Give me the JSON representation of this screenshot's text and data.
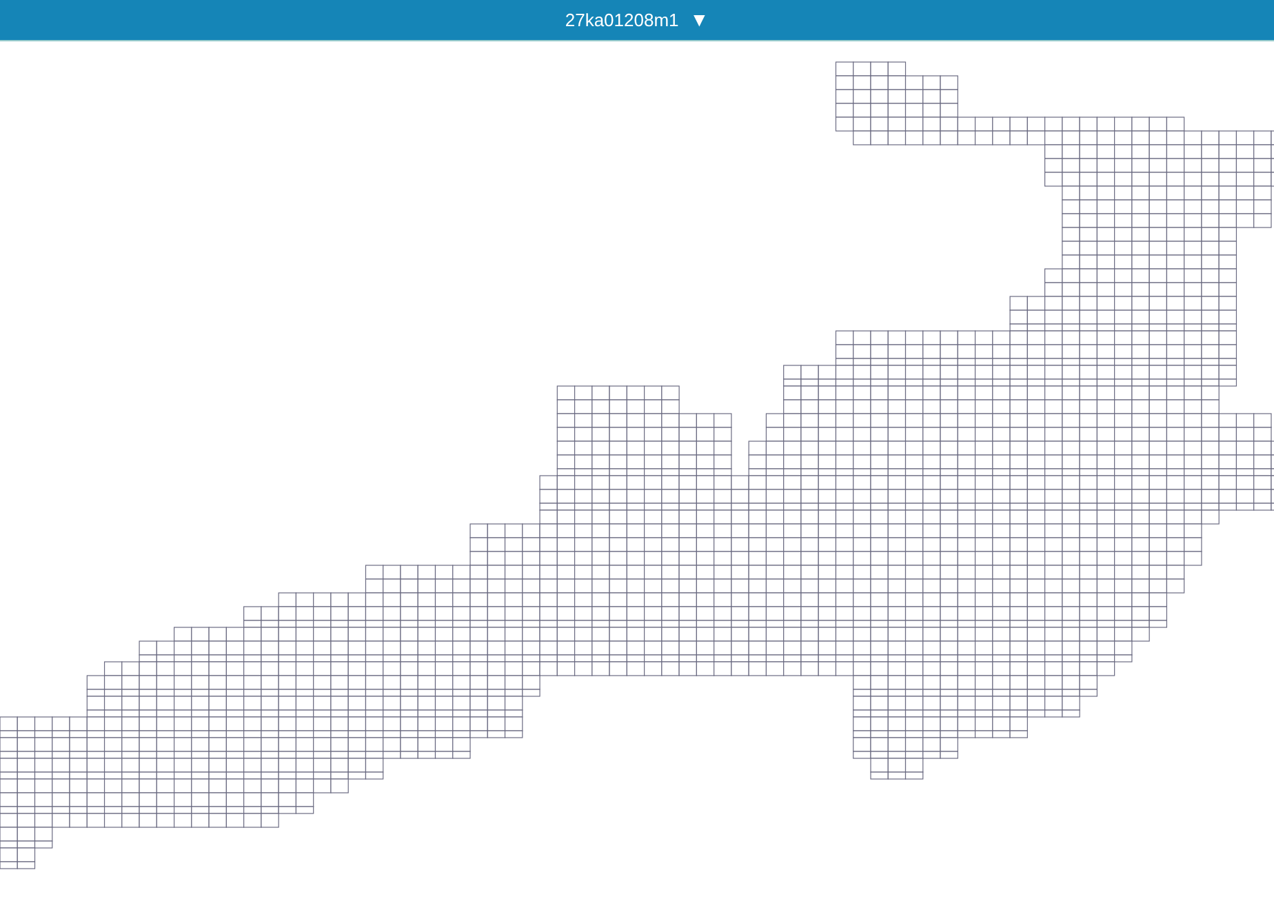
{
  "header": {
    "title": "27ka01208m1",
    "dropdown_arrow": "▼"
  }
}
